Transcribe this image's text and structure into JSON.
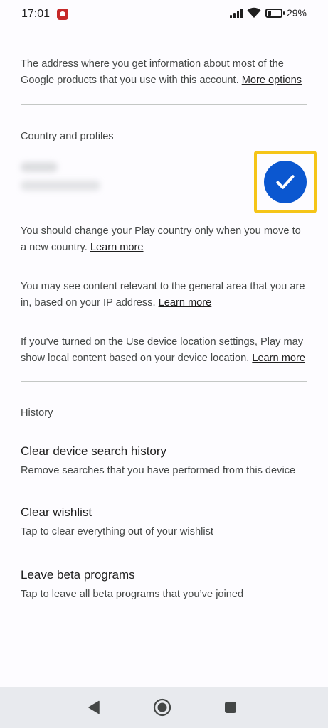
{
  "status_bar": {
    "time": "17:01",
    "battery_text": "29%",
    "battery_level": 0.29
  },
  "account": {
    "address_text": "The address where you get information about most of the Google products that you use with this account. ",
    "more_options_link": "More options"
  },
  "country": {
    "section_label": "Country and profiles",
    "selected": true,
    "change_text": "You should change your Play country only when you move to a new country. ",
    "change_link": "Learn more",
    "ip_text": "You may see content relevant to the general area that you are in, based on your IP address. ",
    "ip_link": "Learn more",
    "location_text": "If you've turned on the Use device location settings, Play may show local content based on your device location. ",
    "location_link": "Learn more"
  },
  "history": {
    "section_label": "History",
    "items": [
      {
        "title": "Clear device search history",
        "description": "Remove searches that you have performed from this device"
      },
      {
        "title": "Clear wishlist",
        "description": "Tap to clear everything out of your wishlist"
      },
      {
        "title": "Leave beta programs",
        "description": "Tap to leave all beta programs that you’ve joined"
      }
    ]
  },
  "colors": {
    "accent": "#0b57d0",
    "highlight": "#f5c518"
  }
}
